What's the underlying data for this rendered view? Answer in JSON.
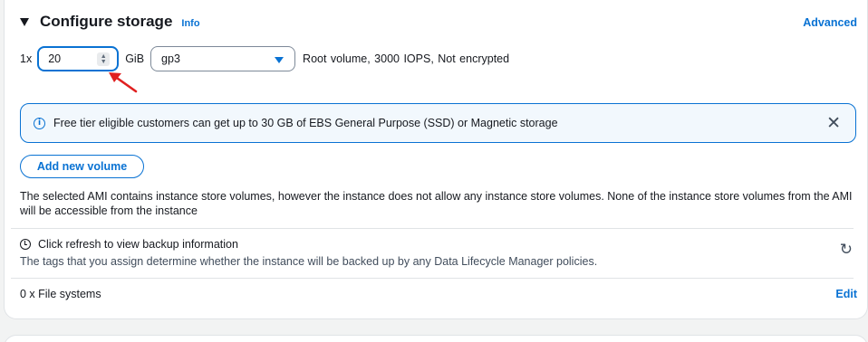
{
  "section": {
    "title": "Configure storage",
    "info_label": "Info",
    "advanced_label": "Advanced"
  },
  "volume": {
    "multiplier": "1x",
    "size_value": "20",
    "unit": "GiB",
    "type_selected": "gp3",
    "description": "Root volume,  3000 IOPS,  Not encrypted"
  },
  "alert": {
    "text": "Free tier eligible customers can get up to 30 GB of EBS General Purpose (SSD) or Magnetic storage",
    "close_glyph": "✕"
  },
  "add_volume_label": "Add new volume",
  "ami_note": "The selected AMI contains instance store volumes, however the instance does not allow any instance store volumes. None of the instance store volumes from the AMI will be accessible from the instance",
  "backup": {
    "title": "Click refresh to view backup information",
    "subtitle": "The tags that you assign determine whether the instance will be backed up by any Data Lifecycle Manager policies.",
    "refresh_glyph": "↻"
  },
  "file_systems": {
    "label": "0 x File systems",
    "edit_label": "Edit"
  },
  "colors": {
    "accent": "#0972d3",
    "annotation_arrow": "#e02020",
    "alert_bg": "#f2f8fd"
  },
  "icons": {
    "caret": "expand-caret-icon",
    "info": "info-circle-icon",
    "close": "close-icon",
    "clock": "clock-icon",
    "refresh": "refresh-icon",
    "dropdown": "dropdown-caret-icon"
  }
}
